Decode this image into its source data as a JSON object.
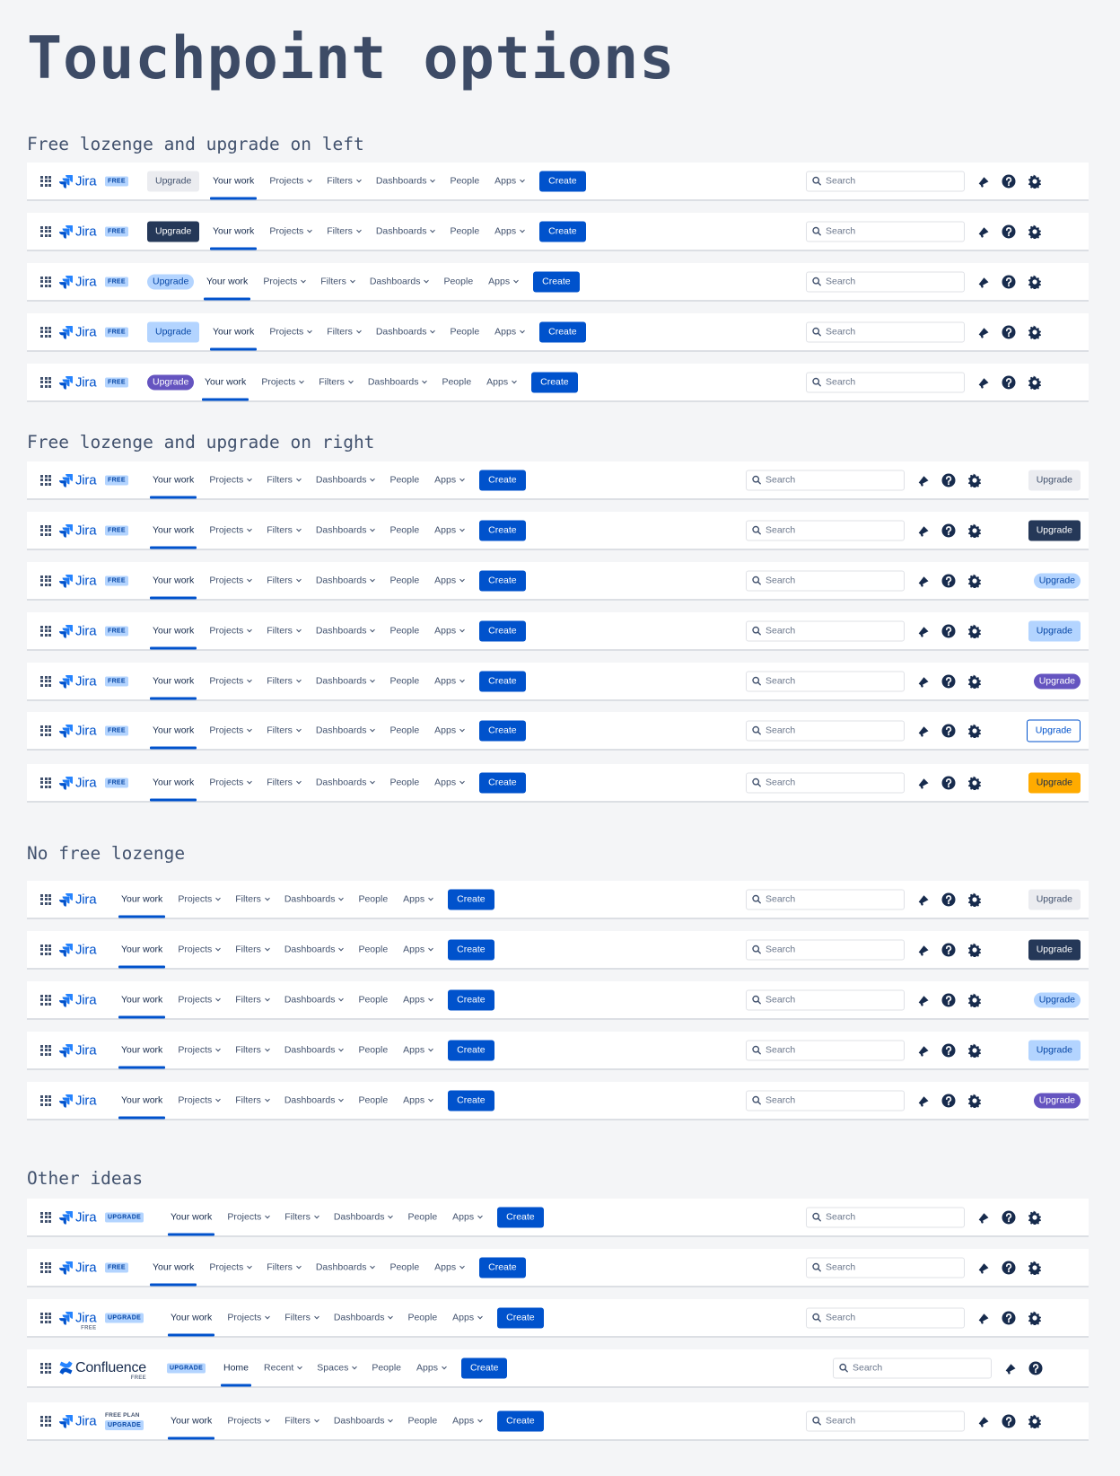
{
  "page": {
    "title": "Touchpoint options",
    "sections": [
      "Free lozenge and upgrade on left",
      "Free lozenge and upgrade on right",
      "No free lozenge",
      "Other ideas"
    ]
  },
  "labels": {
    "jira": "Jira",
    "confluence": "Confluence",
    "free": "FREE",
    "free_plan": "FREE PLAN",
    "upgrade_lozenge": "UPGRADE",
    "upgrade": "Upgrade",
    "create": "Create",
    "search_placeholder": "Search",
    "jira_nav": [
      {
        "label": "Your work",
        "dropdown": false
      },
      {
        "label": "Projects",
        "dropdown": true
      },
      {
        "label": "Filters",
        "dropdown": true
      },
      {
        "label": "Dashboards",
        "dropdown": true
      },
      {
        "label": "People",
        "dropdown": false
      },
      {
        "label": "Apps",
        "dropdown": true
      }
    ],
    "confluence_nav": [
      {
        "label": "Home",
        "dropdown": false
      },
      {
        "label": "Recent",
        "dropdown": true
      },
      {
        "label": "Spaces",
        "dropdown": true
      },
      {
        "label": "People",
        "dropdown": false
      },
      {
        "label": "Apps",
        "dropdown": true
      }
    ]
  },
  "icons": {
    "app_switcher": "app-switcher-icon",
    "jira_logo": "jira-logo-icon",
    "confluence_logo": "confluence-logo-icon",
    "search": "search-icon",
    "notifications": "megaphone-icon",
    "help": "help-icon",
    "settings": "gear-icon"
  },
  "colors": {
    "brand_blue": "#0052cc",
    "upgrade_subtle": "#ebecf0",
    "upgrade_dark": "#253858",
    "upgrade_light_blue": "#b3d4ff",
    "upgrade_purple": "#6554c0",
    "upgrade_yellow": "#ffab00",
    "page_bg": "#f4f5f7"
  },
  "rows": [
    {
      "section": 0,
      "product": "jira",
      "lozenge": "free",
      "upgrade_position": "left",
      "upgrade_style": "subtle"
    },
    {
      "section": 0,
      "product": "jira",
      "lozenge": "free",
      "upgrade_position": "left",
      "upgrade_style": "dark"
    },
    {
      "section": 0,
      "product": "jira",
      "lozenge": "free",
      "upgrade_position": "left",
      "upgrade_style": "light-blue-pill"
    },
    {
      "section": 0,
      "product": "jira",
      "lozenge": "free",
      "upgrade_position": "left",
      "upgrade_style": "light-blue"
    },
    {
      "section": 0,
      "product": "jira",
      "lozenge": "free",
      "upgrade_position": "left",
      "upgrade_style": "purple-pill"
    },
    {
      "section": 1,
      "product": "jira",
      "lozenge": "free",
      "upgrade_position": "right",
      "upgrade_style": "subtle"
    },
    {
      "section": 1,
      "product": "jira",
      "lozenge": "free",
      "upgrade_position": "right",
      "upgrade_style": "dark"
    },
    {
      "section": 1,
      "product": "jira",
      "lozenge": "free",
      "upgrade_position": "right",
      "upgrade_style": "light-blue-pill"
    },
    {
      "section": 1,
      "product": "jira",
      "lozenge": "free",
      "upgrade_position": "right",
      "upgrade_style": "light-blue"
    },
    {
      "section": 1,
      "product": "jira",
      "lozenge": "free",
      "upgrade_position": "right",
      "upgrade_style": "purple-pill"
    },
    {
      "section": 1,
      "product": "jira",
      "lozenge": "free",
      "upgrade_position": "right",
      "upgrade_style": "outline"
    },
    {
      "section": 1,
      "product": "jira",
      "lozenge": "free",
      "upgrade_position": "right",
      "upgrade_style": "yellow"
    },
    {
      "section": 2,
      "product": "jira",
      "lozenge": "none",
      "upgrade_position": "right",
      "upgrade_style": "subtle"
    },
    {
      "section": 2,
      "product": "jira",
      "lozenge": "none",
      "upgrade_position": "right",
      "upgrade_style": "dark"
    },
    {
      "section": 2,
      "product": "jira",
      "lozenge": "none",
      "upgrade_position": "right",
      "upgrade_style": "light-blue-pill"
    },
    {
      "section": 2,
      "product": "jira",
      "lozenge": "none",
      "upgrade_position": "right",
      "upgrade_style": "light-blue"
    },
    {
      "section": 2,
      "product": "jira",
      "lozenge": "none",
      "upgrade_position": "right",
      "upgrade_style": "purple-pill"
    },
    {
      "section": 3,
      "product": "jira",
      "lozenge": "upgrade",
      "upgrade_position": "none"
    },
    {
      "section": 3,
      "product": "jira",
      "lozenge": "free",
      "upgrade_position": "none"
    },
    {
      "section": 3,
      "product": "jira",
      "lozenge": "upgrade",
      "logo_sub": "free",
      "upgrade_position": "none"
    },
    {
      "section": 3,
      "product": "confluence",
      "lozenge": "upgrade",
      "logo_sub": "free",
      "upgrade_position": "none"
    },
    {
      "section": 3,
      "product": "jira",
      "lozenge": "free-plan-upgrade",
      "upgrade_position": "none"
    }
  ]
}
